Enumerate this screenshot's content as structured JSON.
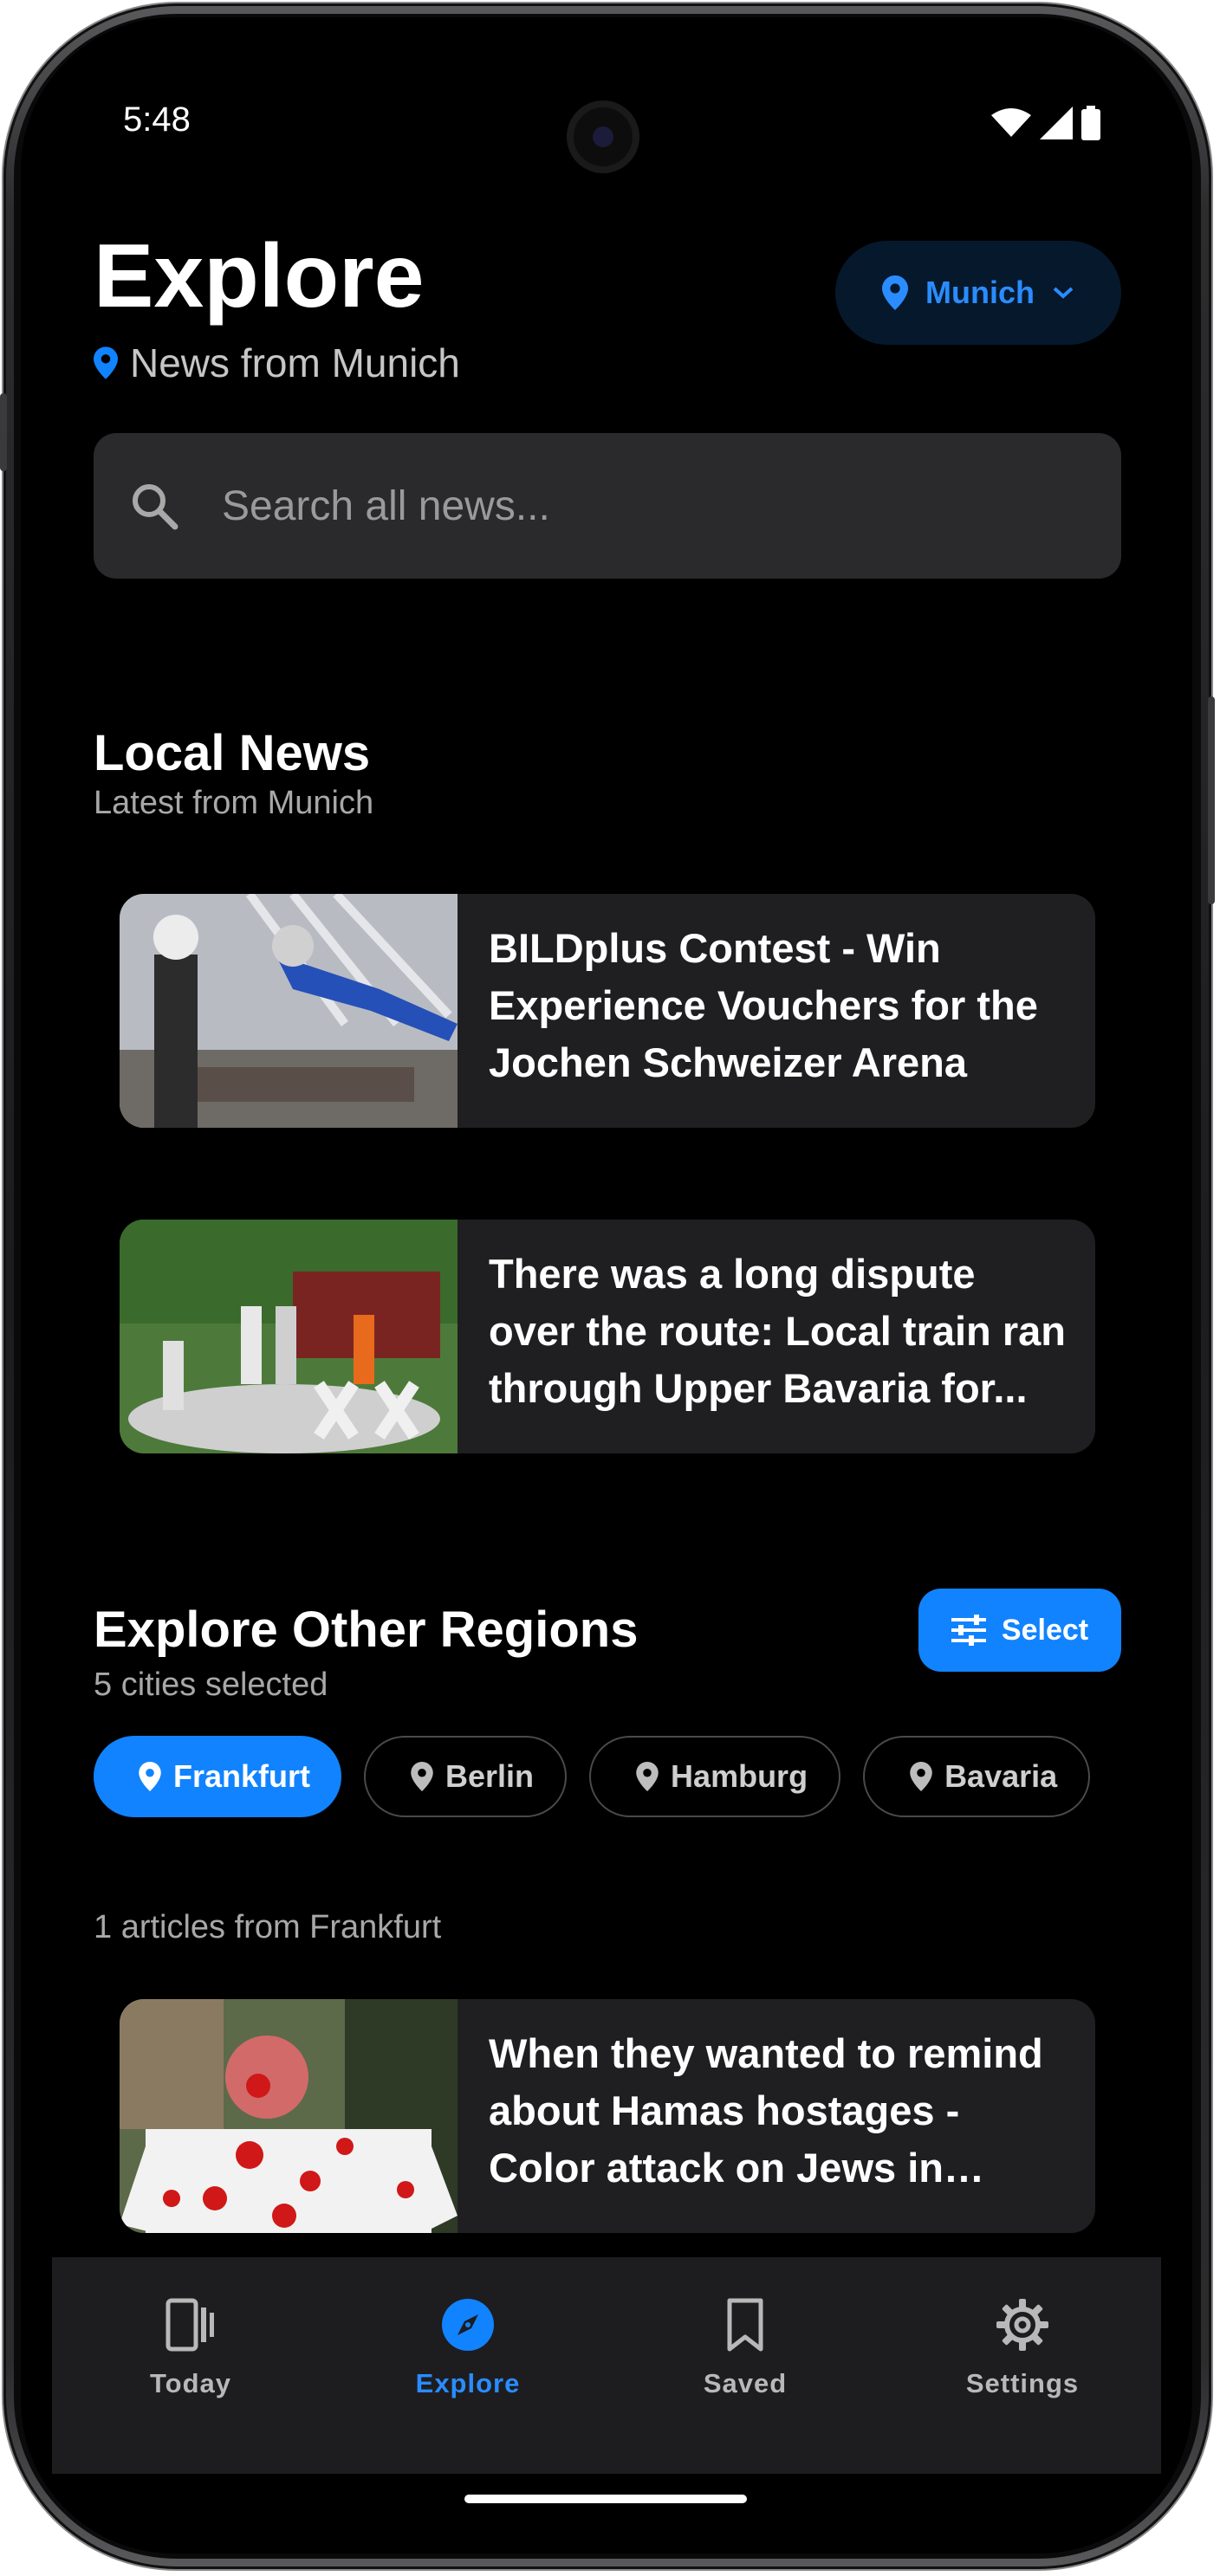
{
  "status": {
    "time": "5:48"
  },
  "header": {
    "title": "Explore",
    "subtitle": "News from Munich",
    "city_selector": "Munich"
  },
  "search": {
    "placeholder": "Search all news..."
  },
  "local_news": {
    "title": "Local News",
    "subtitle": "Latest from Munich",
    "articles": [
      {
        "headline": "BILDplus Contest - Win Experience Vouchers for the Jochen Schweizer Arena"
      },
      {
        "headline": "There was a long dispute over the route: Local train ran through Upper Bavaria for..."
      }
    ]
  },
  "regions": {
    "title": "Explore Other Regions",
    "subtitle": "5 cities selected",
    "select_label": "Select",
    "chips": [
      "Frankfurt",
      "Berlin",
      "Hamburg",
      "Bavaria"
    ],
    "active_chip": "Frankfurt",
    "count_text": "1 articles from Frankfurt",
    "articles": [
      {
        "headline": "When they wanted to remind about Hamas hostages - Color attack on Jews in Frankfurt"
      }
    ]
  },
  "nav": {
    "items": [
      {
        "label": "Today",
        "icon": "tablet-icon"
      },
      {
        "label": "Explore",
        "icon": "compass-icon"
      },
      {
        "label": "Saved",
        "icon": "bookmark-icon"
      },
      {
        "label": "Settings",
        "icon": "gear-icon"
      }
    ],
    "active": "Explore"
  },
  "colors": {
    "accent": "#1183ff",
    "background": "#000000",
    "card": "#1f1f21"
  }
}
